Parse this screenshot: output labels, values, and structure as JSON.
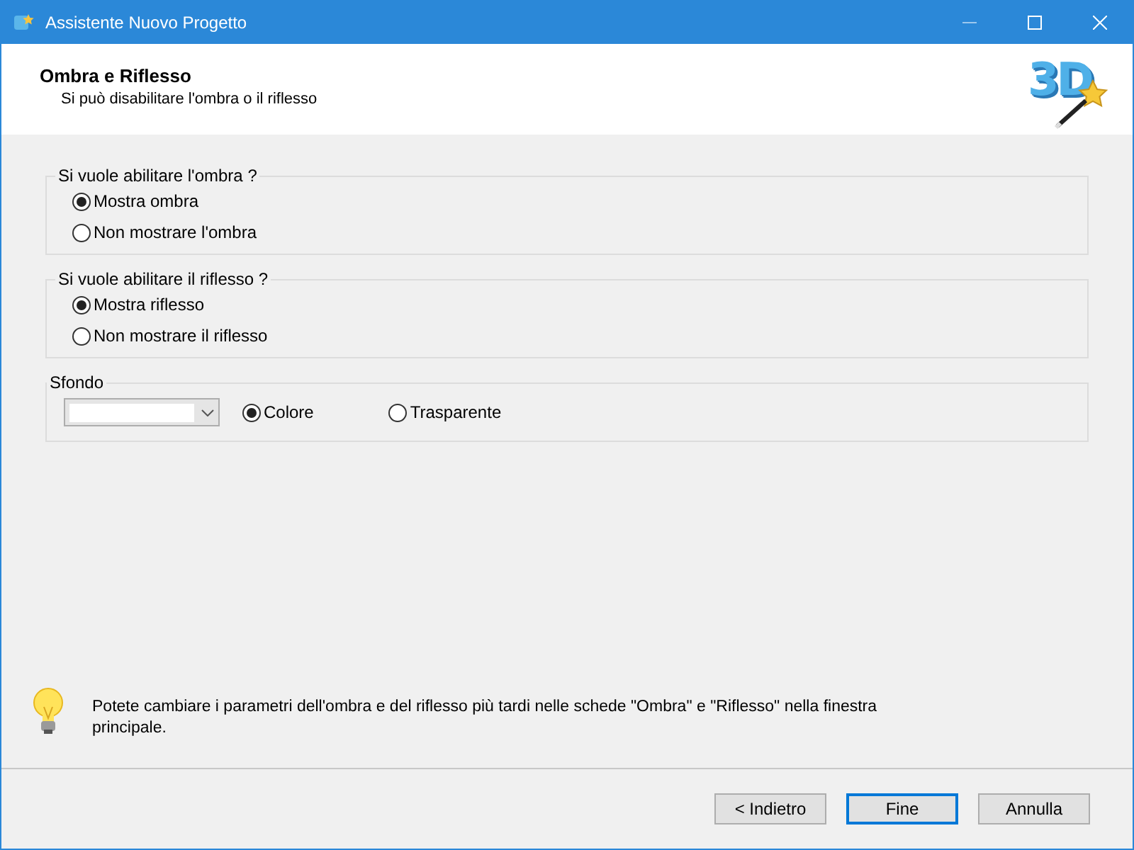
{
  "window": {
    "title": "Assistente Nuovo Progetto"
  },
  "header": {
    "title": "Ombra e Riflesso",
    "subtitle": "Si può disabilitare l'ombra o il riflesso",
    "logo_text": "3D"
  },
  "groups": [
    {
      "legend": "Si vuole abilitare l'ombra ?",
      "options": [
        {
          "label": "Mostra ombra",
          "selected": true
        },
        {
          "label": "Non mostrare l'ombra",
          "selected": false
        }
      ]
    },
    {
      "legend": "Si vuole abilitare il riflesso ?",
      "options": [
        {
          "label": "Mostra riflesso",
          "selected": true
        },
        {
          "label": "Non mostrare il riflesso",
          "selected": false
        }
      ]
    }
  ],
  "background": {
    "legend": "Sfondo",
    "options": [
      {
        "label": "Colore",
        "selected": true
      },
      {
        "label": "Trasparente",
        "selected": false
      }
    ]
  },
  "tip": "Potete cambiare i parametri dell'ombra e del riflesso più tardi nelle schede \"Ombra\" e \"Riflesso\" nella finestra principale.",
  "buttons": [
    {
      "label": "< Indietro",
      "default": false
    },
    {
      "label": "Fine",
      "default": true
    },
    {
      "label": "Annulla",
      "default": false
    }
  ]
}
